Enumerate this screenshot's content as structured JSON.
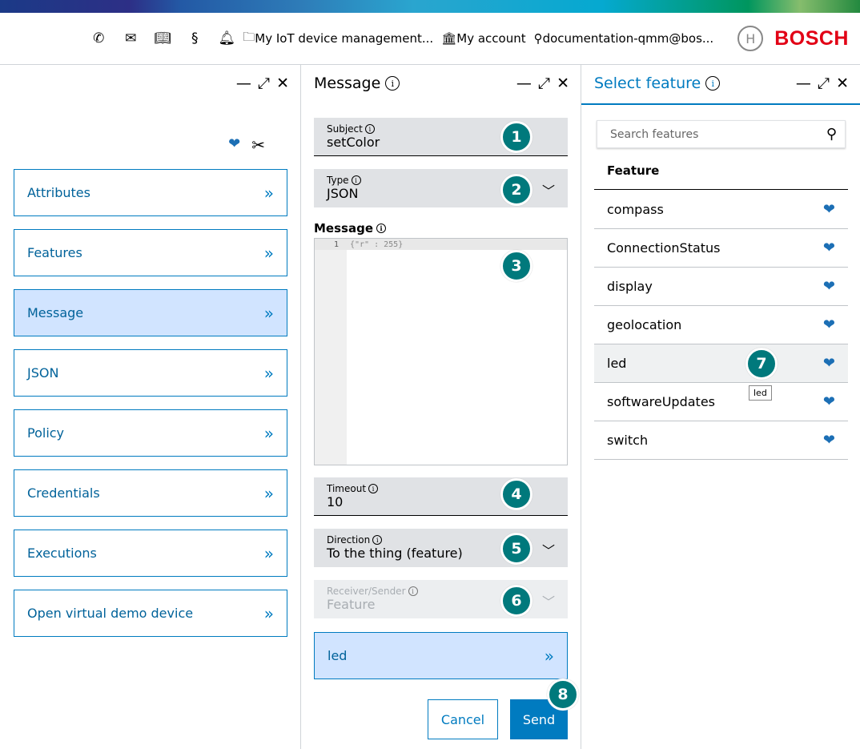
{
  "header": {
    "links": [
      {
        "icon": "folder-icon",
        "label": "My IoT device management..."
      },
      {
        "icon": "building-icon",
        "label": "My account"
      },
      {
        "icon": "user-icon",
        "label": "documentation-qmm@bos..."
      }
    ],
    "icons": [
      "phone-icon",
      "mail-icon",
      "book-icon",
      "section-icon",
      "bell-icon"
    ],
    "brand": "BOSCH"
  },
  "left": {
    "items": [
      "Attributes",
      "Features",
      "Message",
      "JSON",
      "Policy",
      "Credentials",
      "Executions",
      "Open virtual demo device"
    ],
    "active": "Message"
  },
  "message": {
    "title": "Message",
    "subject_label": "Subject",
    "subject_value": "setColor",
    "type_label": "Type",
    "type_value": "JSON",
    "message_label": "Message",
    "code_line_number": "1",
    "code": "{\"r\" : 255}",
    "timeout_label": "Timeout",
    "timeout_value": "10",
    "direction_label": "Direction",
    "direction_value": "To the thing (feature)",
    "receiver_label": "Receiver/Sender",
    "receiver_value": "Feature",
    "selected_feature": "led",
    "cancel": "Cancel",
    "send": "Send"
  },
  "features": {
    "title": "Select feature",
    "search_placeholder": "Search features",
    "column": "Feature",
    "items": [
      "compass",
      "ConnectionStatus",
      "display",
      "geolocation",
      "led",
      "softwareUpdates",
      "switch"
    ],
    "hovered": "led",
    "tooltip": "led"
  },
  "badges": [
    "1",
    "2",
    "3",
    "4",
    "5",
    "6",
    "7",
    "8"
  ],
  "colors": {
    "accent": "#007bc0",
    "active_bg": "#d1e4ff",
    "badge": "#00797c",
    "brand": "#e20015"
  }
}
